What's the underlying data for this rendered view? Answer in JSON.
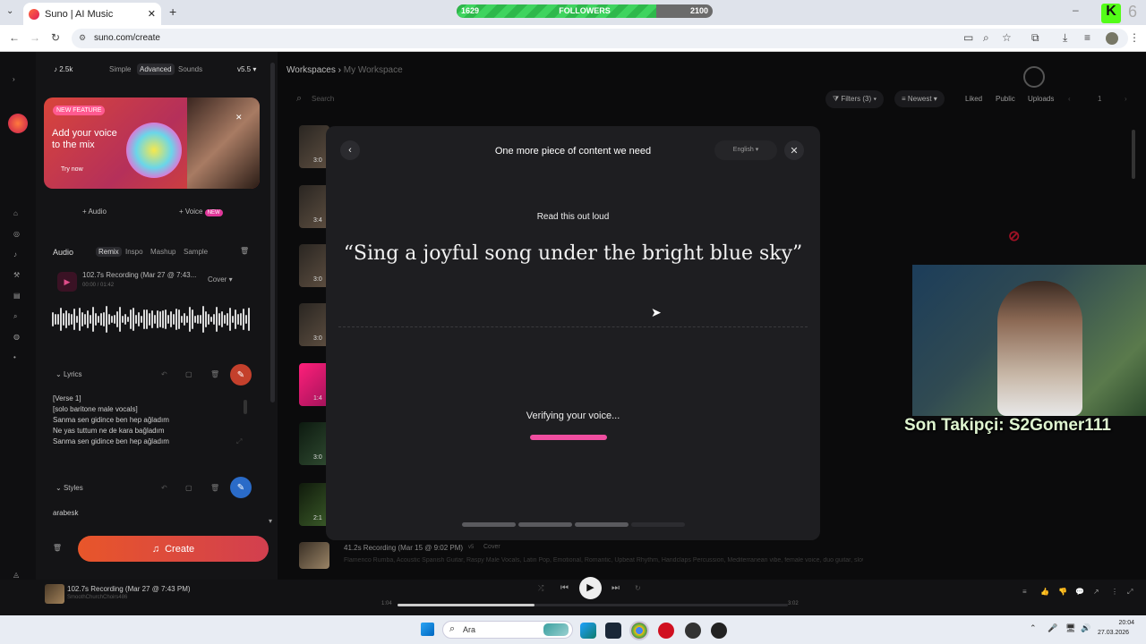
{
  "browser": {
    "tab_title": "Suno | AI Music",
    "url": "suno.com/create"
  },
  "followers_bar": {
    "current": "1629",
    "label": "FOLLOWERS",
    "goal": "2100",
    "progress": 0.78
  },
  "sidebar": {
    "credits": "2.5k",
    "modes": [
      "Simple",
      "Advanced",
      "Sounds"
    ],
    "version": "v5.5",
    "promo": {
      "badge": "NEW FEATURE",
      "title": "Add your voice to the mix",
      "cta": "Try now"
    },
    "add_audio": "Audio",
    "add_voice": "Voice",
    "voice_badge": "NEW",
    "audio_section": {
      "title": "Audio",
      "tabs": [
        "Remix",
        "Inspo",
        "Mashup",
        "Sample"
      ],
      "recording_title": "102.7s Recording (Mar 27 @ 7:43...",
      "recording_time": "00:00 / 01:42",
      "mode": "Cover"
    },
    "lyrics_section": {
      "title": "Lyrics",
      "lines": [
        "[Verse 1]",
        "[solo baritone male vocals]",
        "Sanma sen gidince ben hep ağladım",
        "Ne yas tuttum ne de kara bağladım",
        "Sanma sen gidince ben hep ağladım"
      ]
    },
    "styles_section": {
      "title": "Styles",
      "value": "arabesk"
    },
    "create_label": "Create"
  },
  "main": {
    "breadcrumb": [
      "Workspaces",
      "My Workspace"
    ],
    "search_placeholder": "Search",
    "filters": "Filters (3)",
    "sort": "Newest",
    "toggles": [
      "Liked",
      "Public",
      "Uploads"
    ],
    "track_durations": [
      "3:0",
      "3:4",
      "3:0",
      "3:0",
      "1:4",
      "3:0",
      "2:1"
    ],
    "last_track": {
      "title": "41.2s Recording (Mar 15 @ 9:02 PM)",
      "version": "v5",
      "mode": "Cover",
      "tags": "Flamenco Rumba, Acoustic Spanish Guitar, Raspy Male Vocals, Latin Pop, Emotional, Romantic, Upbeat Rhythm, Handclaps Percussion, Mediterranean vibe, female voice, duo guitar, slow"
    }
  },
  "modal": {
    "title": "One more piece of content we need",
    "language": "English",
    "instruction": "Read this out loud",
    "quote": "“Sing a joyful song under the bright blue sky”",
    "status": "Verifying your voice...",
    "steps_total": 4,
    "steps_done": 3
  },
  "overlay": {
    "follower_label": "Son Takipçi: S2Gomer111"
  },
  "player": {
    "title": "102.7s Recording (Mar 27 @ 7:43 PM)",
    "artist": "SmoothChurchChoirs486",
    "elapsed": "1:04",
    "total": "3:02",
    "progress": 0.35
  },
  "taskbar": {
    "search": "Ara",
    "time": "20:04",
    "date": "27.03.2026"
  }
}
